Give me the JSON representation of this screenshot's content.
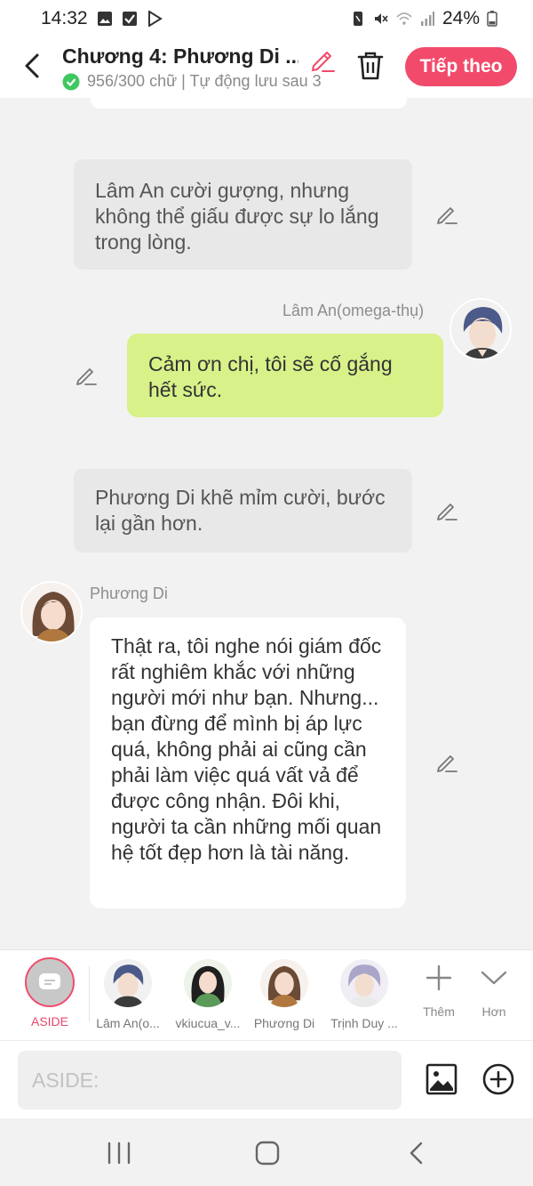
{
  "status_bar": {
    "time": "14:32",
    "battery": "24%",
    "icons_left": [
      "gallery-icon",
      "checkbox-icon",
      "play-store-icon"
    ],
    "icons_right": [
      "nfc-icon",
      "mute-icon",
      "wifi-icon",
      "signal-icon",
      "battery-icon"
    ]
  },
  "header": {
    "title": "Chương 4: Phương Di ...",
    "subtitle": "956/300 chữ | Tự động lưu sau 3",
    "next_label": "Tiếp theo"
  },
  "messages": [
    {
      "type": "narration",
      "text": "Lâm An cười gượng, nhưng không thể giấu được sự lo lắng trong lòng."
    },
    {
      "type": "speech",
      "speaker": "Lâm An(omega-thụ)",
      "text": "Cảm ơn chị, tôi sẽ cố gắng hết sức."
    },
    {
      "type": "narration",
      "text": "Phương Di khẽ mỉm cười, bước lại gần hơn."
    },
    {
      "type": "speech",
      "speaker": "Phương Di",
      "text": "Thật ra, tôi nghe nói giám đốc rất nghiêm khắc với những người mới như bạn. Nhưng... bạn đừng để mình bị áp lực quá, không phải ai cũng cần phải làm việc quá vất vả để được công nhận. Đôi khi, người ta cần những mối quan hệ tốt đẹp hơn là tài năng."
    }
  ],
  "characters": [
    {
      "label": "ASIDE"
    },
    {
      "label": "Lâm An(o..."
    },
    {
      "label": "vkiucua_v..."
    },
    {
      "label": "Phương Di"
    },
    {
      "label": "Trịnh Duy ..."
    }
  ],
  "tools": {
    "more_label": "Thêm",
    "collapse_label": "Hơn"
  },
  "input": {
    "placeholder": "ASIDE:"
  },
  "colors": {
    "accent": "#f24a6a",
    "user_bubble": "#d8f189",
    "narration_bubble": "#e8e8e8"
  }
}
